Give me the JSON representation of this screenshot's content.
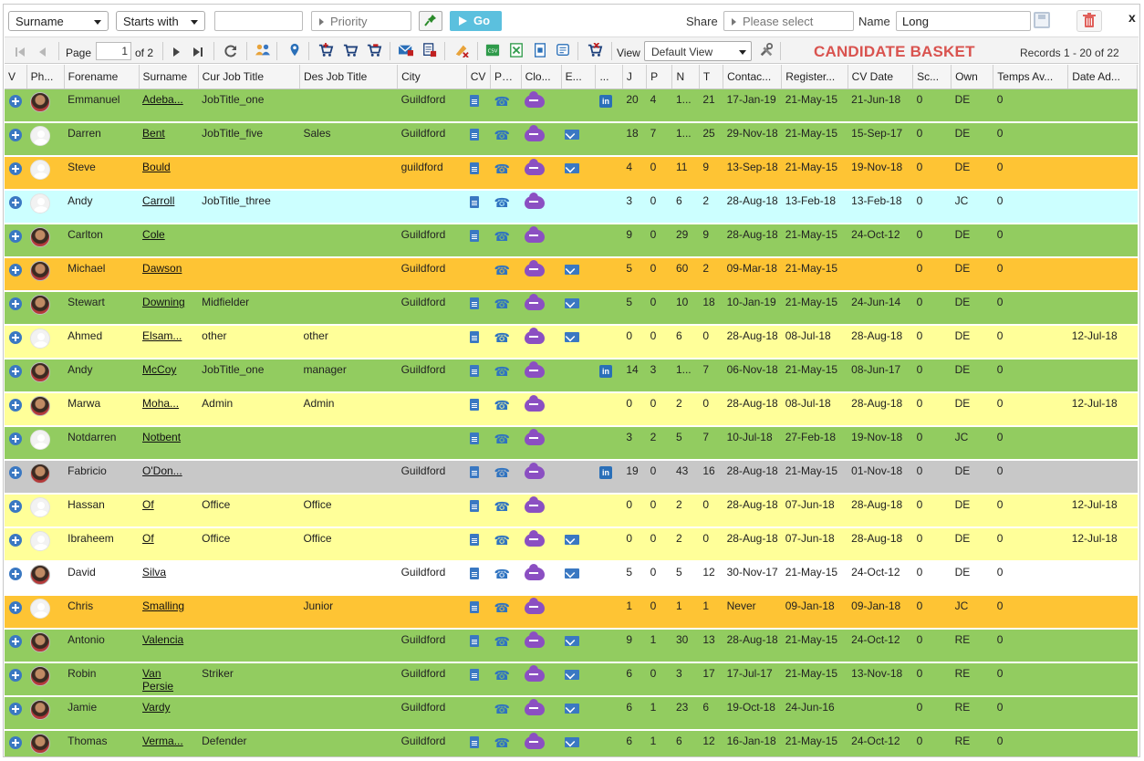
{
  "filter": {
    "field": "Surname",
    "operator": "Starts with",
    "value": "",
    "priority_placeholder": "Priority",
    "go_label": "Go",
    "share_label": "Share",
    "share_placeholder": "Please select",
    "name_label": "Name",
    "name_value": "Long",
    "close_label": "x"
  },
  "toolbar": {
    "page_label": "Page",
    "page_value": "1",
    "page_of": "of 2",
    "view_label": "View",
    "view_value": "Default View",
    "title": "CANDIDATE BASKET",
    "records": "Records 1 - 20 of 22"
  },
  "columns": [
    "V",
    "Ph...",
    "Forename",
    "Surname",
    "Cur Job Title",
    "Des Job Title",
    "City",
    "CV",
    "Ph...",
    "Clo...",
    "E...",
    "...",
    "J",
    "P",
    "N",
    "T",
    "Contac...",
    "Register...",
    "CV Date",
    "Sc...",
    "Own",
    "Temps Av...",
    "Date Ad..."
  ],
  "rows": [
    {
      "color": "green",
      "photo": "photo",
      "forename": "Emmanuel",
      "surname": "Adeba...",
      "cur_job": "JobTitle_one",
      "des_job": "",
      "city": "Guildford",
      "cv": true,
      "email": false,
      "linkedin": true,
      "j": "20",
      "p": "4",
      "n": "1...",
      "t": "21",
      "contact": "17-Jan-19",
      "registered": "21-May-15",
      "cv_date": "21-Jun-18",
      "sc": "0",
      "own": "DE",
      "temps": "0",
      "date_added": ""
    },
    {
      "color": "green",
      "photo": "placeholder",
      "forename": "Darren",
      "surname": "Bent",
      "cur_job": "JobTitle_five",
      "des_job": "Sales",
      "city": "Guildford",
      "cv": true,
      "email": true,
      "linkedin": false,
      "j": "18",
      "p": "7",
      "n": "1...",
      "t": "25",
      "contact": "29-Nov-18",
      "registered": "21-May-15",
      "cv_date": "15-Sep-17",
      "sc": "0",
      "own": "DE",
      "temps": "0",
      "date_added": ""
    },
    {
      "color": "orange",
      "photo": "placeholder",
      "forename": "Steve",
      "surname": "Bould",
      "cur_job": "",
      "des_job": "",
      "city": "guildford",
      "cv": true,
      "email": true,
      "linkedin": false,
      "j": "4",
      "p": "0",
      "n": "11",
      "t": "9",
      "contact": "13-Sep-18",
      "registered": "21-May-15",
      "cv_date": "19-Nov-18",
      "sc": "0",
      "own": "DE",
      "temps": "0",
      "date_added": ""
    },
    {
      "color": "cyan",
      "photo": "placeholder",
      "forename": "Andy",
      "surname": "Carroll",
      "cur_job": "JobTitle_three",
      "des_job": "",
      "city": "",
      "cv": true,
      "email": false,
      "linkedin": false,
      "j": "3",
      "p": "0",
      "n": "6",
      "t": "2",
      "contact": "28-Aug-18",
      "registered": "13-Feb-18",
      "cv_date": "13-Feb-18",
      "sc": "0",
      "own": "JC",
      "temps": "0",
      "date_added": ""
    },
    {
      "color": "green",
      "photo": "photo",
      "forename": "Carlton",
      "surname": "Cole",
      "cur_job": "",
      "des_job": "",
      "city": "Guildford",
      "cv": true,
      "email": false,
      "linkedin": false,
      "j": "9",
      "p": "0",
      "n": "29",
      "t": "9",
      "contact": "28-Aug-18",
      "registered": "21-May-15",
      "cv_date": "24-Oct-12",
      "sc": "0",
      "own": "DE",
      "temps": "0",
      "date_added": ""
    },
    {
      "color": "orange",
      "photo": "photo",
      "forename": "Michael",
      "surname": "Dawson",
      "cur_job": "",
      "des_job": "",
      "city": "Guildford",
      "cv": false,
      "email": true,
      "linkedin": false,
      "j": "5",
      "p": "0",
      "n": "60",
      "t": "2",
      "contact": "09-Mar-18",
      "registered": "21-May-15",
      "cv_date": "",
      "sc": "0",
      "own": "DE",
      "temps": "0",
      "date_added": ""
    },
    {
      "color": "green",
      "photo": "photo",
      "forename": "Stewart",
      "surname": "Downing",
      "cur_job": "Midfielder",
      "des_job": "",
      "city": "Guildford",
      "cv": true,
      "email": true,
      "linkedin": false,
      "j": "5",
      "p": "0",
      "n": "10",
      "t": "18",
      "contact": "10-Jan-19",
      "registered": "21-May-15",
      "cv_date": "24-Jun-14",
      "sc": "0",
      "own": "DE",
      "temps": "0",
      "date_added": ""
    },
    {
      "color": "yellow",
      "photo": "placeholder",
      "forename": "Ahmed",
      "surname": "Elsam...",
      "cur_job": "other",
      "des_job": "other",
      "city": "",
      "cv": true,
      "email": true,
      "linkedin": false,
      "j": "0",
      "p": "0",
      "n": "6",
      "t": "0",
      "contact": "28-Aug-18",
      "registered": "08-Jul-18",
      "cv_date": "28-Aug-18",
      "sc": "0",
      "own": "DE",
      "temps": "0",
      "date_added": "12-Jul-18"
    },
    {
      "color": "green",
      "photo": "photo",
      "forename": "Andy",
      "surname": "McCoy",
      "cur_job": "JobTitle_one",
      "des_job": "manager",
      "city": "Guildford",
      "cv": true,
      "email": false,
      "linkedin": true,
      "j": "14",
      "p": "3",
      "n": "1...",
      "t": "7",
      "contact": "06-Nov-18",
      "registered": "21-May-15",
      "cv_date": "08-Jun-17",
      "sc": "0",
      "own": "DE",
      "temps": "0",
      "date_added": ""
    },
    {
      "color": "yellow",
      "photo": "photo",
      "forename": "Marwa",
      "surname": "Moha...",
      "cur_job": "Admin",
      "des_job": "Admin",
      "city": "",
      "cv": true,
      "email": false,
      "linkedin": false,
      "j": "0",
      "p": "0",
      "n": "2",
      "t": "0",
      "contact": "28-Aug-18",
      "registered": "08-Jul-18",
      "cv_date": "28-Aug-18",
      "sc": "0",
      "own": "DE",
      "temps": "0",
      "date_added": "12-Jul-18"
    },
    {
      "color": "green",
      "photo": "placeholder",
      "forename": "Notdarren",
      "surname": "Notbent",
      "cur_job": "",
      "des_job": "",
      "city": "",
      "cv": true,
      "email": false,
      "linkedin": false,
      "j": "3",
      "p": "2",
      "n": "5",
      "t": "7",
      "contact": "10-Jul-18",
      "registered": "27-Feb-18",
      "cv_date": "19-Nov-18",
      "sc": "0",
      "own": "JC",
      "temps": "0",
      "date_added": ""
    },
    {
      "color": "grey",
      "photo": "photo",
      "forename": "Fabricio",
      "surname": "O'Don...",
      "cur_job": "",
      "des_job": "",
      "city": "Guildford",
      "cv": true,
      "email": false,
      "linkedin": true,
      "j": "19",
      "p": "0",
      "n": "43",
      "t": "16",
      "contact": "28-Aug-18",
      "registered": "21-May-15",
      "cv_date": "01-Nov-18",
      "sc": "0",
      "own": "DE",
      "temps": "0",
      "date_added": ""
    },
    {
      "color": "yellow",
      "photo": "placeholder",
      "forename": "Hassan",
      "surname": "Of",
      "cur_job": "Office",
      "des_job": "Office",
      "city": "",
      "cv": true,
      "email": false,
      "linkedin": false,
      "j": "0",
      "p": "0",
      "n": "2",
      "t": "0",
      "contact": "28-Aug-18",
      "registered": "07-Jun-18",
      "cv_date": "28-Aug-18",
      "sc": "0",
      "own": "DE",
      "temps": "0",
      "date_added": "12-Jul-18"
    },
    {
      "color": "yellow",
      "photo": "placeholder",
      "forename": "Ibraheem",
      "surname": "Of",
      "cur_job": "Office",
      "des_job": "Office",
      "city": "",
      "cv": true,
      "email": true,
      "linkedin": false,
      "j": "0",
      "p": "0",
      "n": "2",
      "t": "0",
      "contact": "28-Aug-18",
      "registered": "07-Jun-18",
      "cv_date": "28-Aug-18",
      "sc": "0",
      "own": "DE",
      "temps": "0",
      "date_added": "12-Jul-18"
    },
    {
      "color": "white",
      "photo": "photo",
      "forename": "David",
      "surname": "Silva",
      "cur_job": "",
      "des_job": "",
      "city": "Guildford",
      "cv": true,
      "email": true,
      "linkedin": false,
      "j": "5",
      "p": "0",
      "n": "5",
      "t": "12",
      "contact": "30-Nov-17",
      "registered": "21-May-15",
      "cv_date": "24-Oct-12",
      "sc": "0",
      "own": "DE",
      "temps": "0",
      "date_added": ""
    },
    {
      "color": "orange",
      "photo": "placeholder",
      "forename": "Chris",
      "surname": "Smalling",
      "cur_job": "",
      "des_job": "Junior",
      "city": "",
      "cv": true,
      "email": false,
      "linkedin": false,
      "j": "1",
      "p": "0",
      "n": "1",
      "t": "1",
      "contact": "Never",
      "registered": "09-Jan-18",
      "cv_date": "09-Jan-18",
      "sc": "0",
      "own": "JC",
      "temps": "0",
      "date_added": ""
    },
    {
      "color": "green",
      "photo": "photo",
      "forename": "Antonio",
      "surname": "Valencia",
      "cur_job": "",
      "des_job": "",
      "city": "Guildford",
      "cv": true,
      "email": true,
      "linkedin": false,
      "j": "9",
      "p": "1",
      "n": "30",
      "t": "13",
      "contact": "28-Aug-18",
      "registered": "21-May-15",
      "cv_date": "24-Oct-12",
      "sc": "0",
      "own": "RE",
      "temps": "0",
      "date_added": ""
    },
    {
      "color": "green",
      "photo": "photo",
      "forename": "Robin",
      "surname": "Van Persie",
      "cur_job": "Striker",
      "des_job": "",
      "city": "Guildford",
      "cv": true,
      "email": true,
      "linkedin": false,
      "j": "6",
      "p": "0",
      "n": "3",
      "t": "17",
      "contact": "17-Jul-17",
      "registered": "21-May-15",
      "cv_date": "13-Nov-18",
      "sc": "0",
      "own": "RE",
      "temps": "0",
      "date_added": ""
    },
    {
      "color": "green",
      "photo": "photo",
      "forename": "Jamie",
      "surname": "Vardy",
      "cur_job": "",
      "des_job": "",
      "city": "Guildford",
      "cv": false,
      "email": true,
      "linkedin": false,
      "j": "6",
      "p": "1",
      "n": "23",
      "t": "6",
      "contact": "19-Oct-18",
      "registered": "24-Jun-16",
      "cv_date": "",
      "sc": "0",
      "own": "RE",
      "temps": "0",
      "date_added": ""
    },
    {
      "color": "green",
      "photo": "photo",
      "forename": "Thomas",
      "surname": "Verma...",
      "cur_job": "Defender",
      "des_job": "",
      "city": "Guildford",
      "cv": true,
      "email": true,
      "linkedin": false,
      "j": "6",
      "p": "1",
      "n": "6",
      "t": "12",
      "contact": "16-Jan-18",
      "registered": "21-May-15",
      "cv_date": "24-Oct-12",
      "sc": "0",
      "own": "RE",
      "temps": "0",
      "date_added": ""
    }
  ],
  "colors": {
    "green": "#92cc60",
    "orange": "#fec434",
    "cyan": "#ccffff",
    "yellow": "#ffff99",
    "grey": "#c8c8c8",
    "white": "#ffffff",
    "accent": "#3a78c2",
    "title": "#d9534f",
    "go": "#5bc0de",
    "cloud": "#8b4fc2"
  },
  "icons": {
    "expand": "plus-circle-icon",
    "cv": "document-icon",
    "phone": "phone-icon",
    "cloud": "cloud-icon",
    "email": "envelope-icon",
    "linkedin": "linkedin-icon",
    "pin": "pin-icon",
    "save": "save-icon",
    "delete": "trash-icon"
  }
}
